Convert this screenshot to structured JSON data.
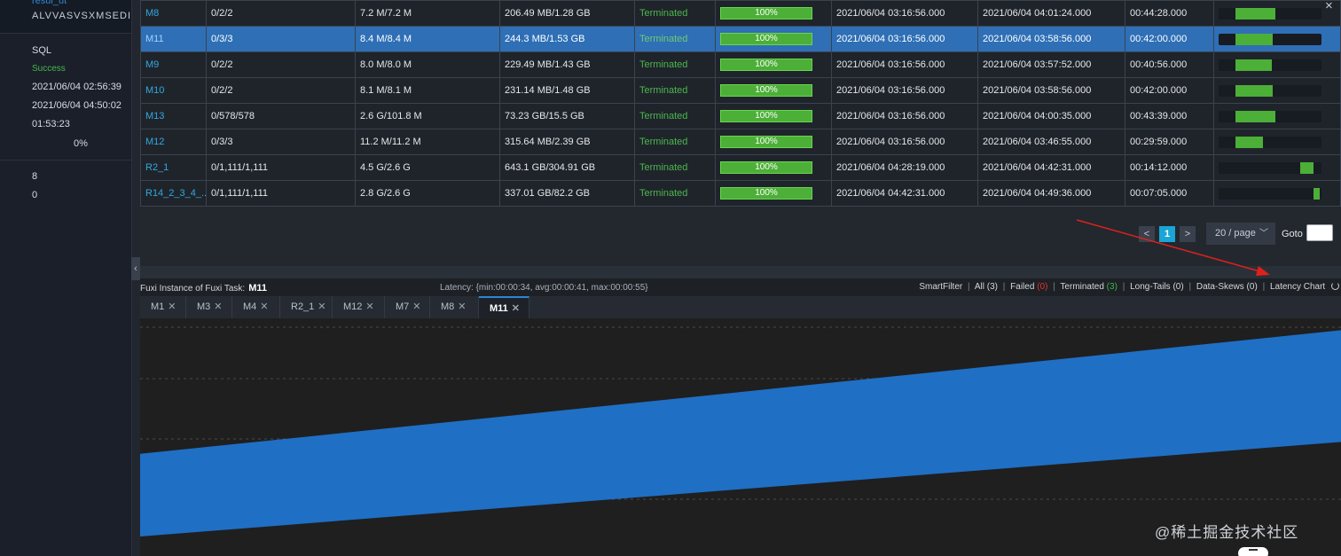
{
  "left": {
    "top_line1": "resul_ut",
    "top_line2": "ALVVASVSXMSEDISSS",
    "type": "SQL",
    "status": "Success",
    "start_time": "2021/06/04 02:56:39",
    "end_time": "2021/06/04 04:50:02",
    "duration": "01:53:23",
    "progress": "0%",
    "val_a": "8",
    "val_b": "0",
    "colors": {
      "success": "#4cb64c"
    }
  },
  "table": {
    "rows": [
      {
        "name": "M8",
        "instances": "0/2/2",
        "io_records": "7.2 M/7.2 M",
        "io_bytes": "206.49 MB/1.28 GB",
        "status": "Terminated",
        "progress": "100%",
        "start": "2021/06/04 03:16:56.000",
        "end": "2021/06/04 04:01:24.000",
        "latency": "00:44:28.000",
        "timeline_start": 0.16,
        "timeline_len": 0.39,
        "selected": false
      },
      {
        "name": "M11",
        "instances": "0/3/3",
        "io_records": "8.4 M/8.4 M",
        "io_bytes": "244.3 MB/1.53 GB",
        "status": "Terminated",
        "progress": "100%",
        "start": "2021/06/04 03:16:56.000",
        "end": "2021/06/04 03:58:56.000",
        "latency": "00:42:00.000",
        "timeline_start": 0.16,
        "timeline_len": 0.37,
        "selected": true
      },
      {
        "name": "M9",
        "instances": "0/2/2",
        "io_records": "8.0 M/8.0 M",
        "io_bytes": "229.49 MB/1.43 GB",
        "status": "Terminated",
        "progress": "100%",
        "start": "2021/06/04 03:16:56.000",
        "end": "2021/06/04 03:57:52.000",
        "latency": "00:40:56.000",
        "timeline_start": 0.16,
        "timeline_len": 0.36,
        "selected": false
      },
      {
        "name": "M10",
        "instances": "0/2/2",
        "io_records": "8.1 M/8.1 M",
        "io_bytes": "231.14 MB/1.48 GB",
        "status": "Terminated",
        "progress": "100%",
        "start": "2021/06/04 03:16:56.000",
        "end": "2021/06/04 03:58:56.000",
        "latency": "00:42:00.000",
        "timeline_start": 0.16,
        "timeline_len": 0.37,
        "selected": false
      },
      {
        "name": "M13",
        "instances": "0/578/578",
        "io_records": "2.6 G/101.8 M",
        "io_bytes": "73.23 GB/15.5 GB",
        "status": "Terminated",
        "progress": "100%",
        "start": "2021/06/04 03:16:56.000",
        "end": "2021/06/04 04:00:35.000",
        "latency": "00:43:39.000",
        "timeline_start": 0.16,
        "timeline_len": 0.39,
        "selected": false
      },
      {
        "name": "M12",
        "instances": "0/3/3",
        "io_records": "11.2 M/11.2 M",
        "io_bytes": "315.64 MB/2.39 GB",
        "status": "Terminated",
        "progress": "100%",
        "start": "2021/06/04 03:16:56.000",
        "end": "2021/06/04 03:46:55.000",
        "latency": "00:29:59.000",
        "timeline_start": 0.16,
        "timeline_len": 0.27,
        "selected": false
      },
      {
        "name": "R2_1",
        "instances": "0/1,111/1,111",
        "io_records": "4.5 G/2.6 G",
        "io_bytes": "643.1 GB/304.91 GB",
        "status": "Terminated",
        "progress": "100%",
        "start": "2021/06/04 04:28:19.000",
        "end": "2021/06/04 04:42:31.000",
        "latency": "00:14:12.000",
        "timeline_start": 0.79,
        "timeline_len": 0.13,
        "selected": false
      },
      {
        "name": "R14_2_3_4_...",
        "instances": "0/1,111/1,111",
        "io_records": "2.8 G/2.6 G",
        "io_bytes": "337.01 GB/82.2 GB",
        "status": "Terminated",
        "progress": "100%",
        "start": "2021/06/04 04:42:31.000",
        "end": "2021/06/04 04:49:36.000",
        "latency": "00:07:05.000",
        "timeline_start": 0.92,
        "timeline_len": 0.06,
        "selected": false
      }
    ]
  },
  "pager": {
    "prev": "<",
    "current": "1",
    "next": ">",
    "page_size": "20 / page",
    "goto_label": "Goto",
    "goto_value": ""
  },
  "close_icon": "×",
  "info": {
    "title_prefix": "Fuxi Instance of Fuxi Task:",
    "task": "M11",
    "latency": "Latency: {min:00:00:34, avg:00:00:41, max:00:00:55}",
    "smartfilter": "SmartFilter",
    "all": "All",
    "all_count": "(3)",
    "failed": "Failed",
    "failed_count": "(0)",
    "terminated": "Terminated",
    "terminated_count": "(3)",
    "longtails": "Long-Tails",
    "longtails_count": "(0)",
    "dataskews": "Data-Skews",
    "dataskews_count": "(0)",
    "latency_chart": "Latency Chart"
  },
  "tabs": [
    {
      "label": "M1",
      "active": false
    },
    {
      "label": "M3",
      "active": false
    },
    {
      "label": "M4",
      "active": false
    },
    {
      "label": "R2_1",
      "active": false
    },
    {
      "label": "M12",
      "active": false
    },
    {
      "label": "M7",
      "active": false
    },
    {
      "label": "M8",
      "active": false
    },
    {
      "label": "M11",
      "active": true
    }
  ],
  "chart_data": {
    "type": "area",
    "series": [
      {
        "lower": [
          0.0,
          0.48
        ],
        "upper": [
          0.43,
          0.95
        ]
      }
    ],
    "color": "#1f6fc4",
    "grid": true
  },
  "watermark": "@稀土掘金技术社区",
  "colors": {
    "accent": "#2e6fb6",
    "progress_green": "#4caf37",
    "failed_red": "#e2322f",
    "terminated_green": "#42b544",
    "annotation_arrow": "#e0201c"
  }
}
